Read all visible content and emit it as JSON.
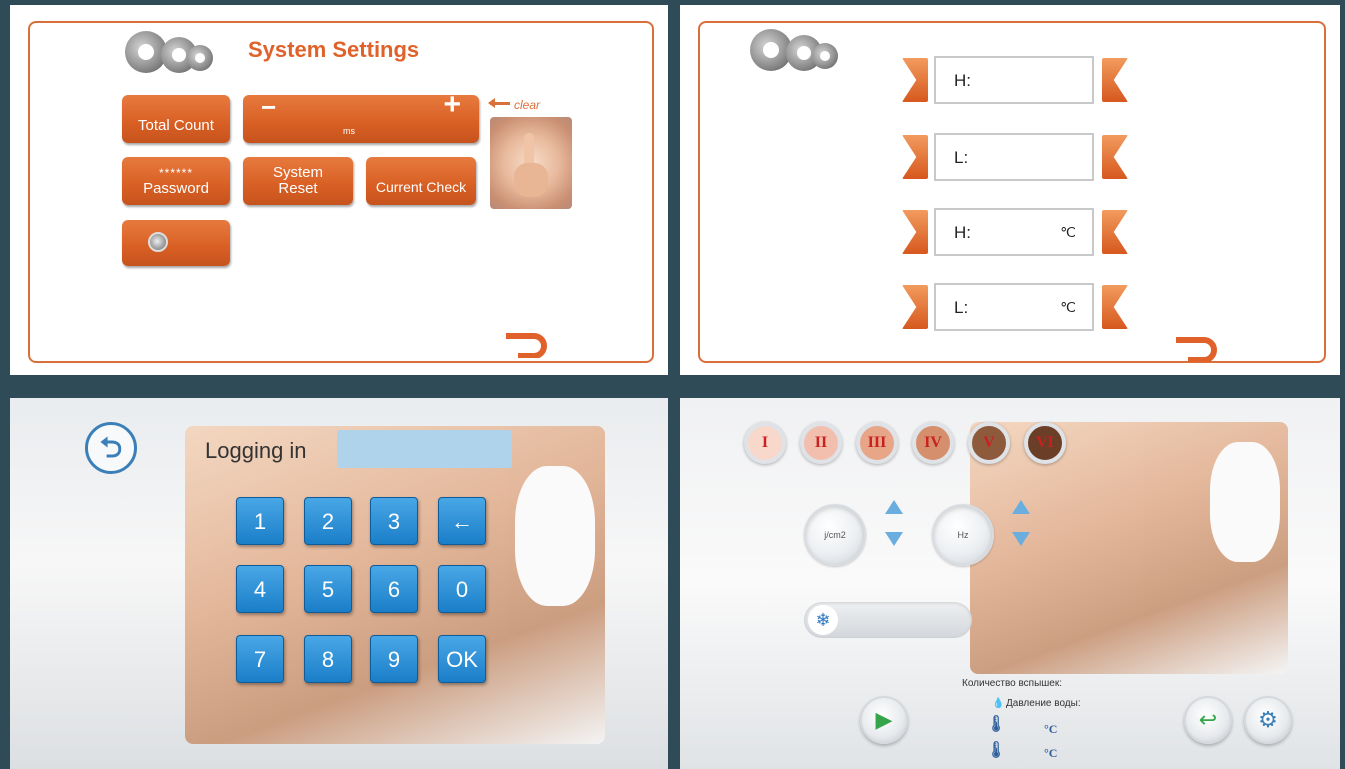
{
  "settings": {
    "title": "System Settings",
    "total_count": "Total Count",
    "time_unit": "ms",
    "minus": "−",
    "plus": "+",
    "clear": "clear",
    "password_mask": "******",
    "password": "Password",
    "system_reset": [
      "System",
      "Reset"
    ],
    "current_check": "Current Check",
    "return_icon": "return-arrow-icon"
  },
  "limits": {
    "rows": [
      {
        "label": "H:",
        "unit": ""
      },
      {
        "label": "L:",
        "unit": ""
      },
      {
        "label": "H:",
        "unit": "℃"
      },
      {
        "label": "L:",
        "unit": "℃"
      }
    ]
  },
  "login": {
    "label": "Logging in",
    "password_value": "",
    "keys": [
      "1",
      "2",
      "3",
      "←",
      "4",
      "5",
      "6",
      "0",
      "7",
      "8",
      "9",
      "OK"
    ]
  },
  "treatment": {
    "skin_types": [
      {
        "label": "I",
        "color": "#f9d8cc"
      },
      {
        "label": "II",
        "color": "#f2bfae"
      },
      {
        "label": "III",
        "color": "#e8a689"
      },
      {
        "label": "IV",
        "color": "#d58f6c"
      },
      {
        "label": "V",
        "color": "#8e5a3c"
      },
      {
        "label": "VI",
        "color": "#6b3f27"
      }
    ],
    "energy_unit": "j/cm2",
    "freq_unit": "Hz",
    "flash_count_label": "Количество вспышек:",
    "water_pressure_label": "Давление воды:",
    "temp_unit_1": "°C",
    "temp_unit_2": "°C"
  },
  "colors": {
    "accent": "#e0622a",
    "frame": "#d9703a",
    "key_blue": "#1a7ec8"
  }
}
